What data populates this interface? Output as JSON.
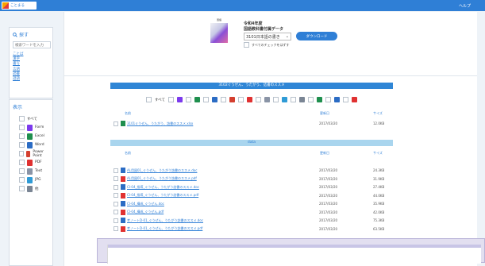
{
  "app": {
    "logo_text": "ことまる",
    "help_label": "ヘルプ"
  },
  "search": {
    "title": "探す",
    "placeholder": "検索ワードを入力",
    "links": [
      "ことば",
      "漢字",
      "書写",
      "言語",
      "読書",
      "話語"
    ]
  },
  "filters": {
    "title": "表示",
    "items": [
      {
        "label": "すべて",
        "icon_color": null
      },
      {
        "label": "Form",
        "icon_color": "#7c3aed"
      },
      {
        "label": "Excel",
        "icon_color": "#1f8f4e"
      },
      {
        "label": "Word",
        "icon_color": "#2b6cc4"
      },
      {
        "label": "Power Point",
        "icon_color": "#d43f2f"
      },
      {
        "label": "PDF",
        "icon_color": "#e03131"
      },
      {
        "label": "Text",
        "icon_color": "#8a94a6"
      },
      {
        "label": "JPG",
        "icon_color": "#2f9bd6"
      },
      {
        "label": "他",
        "icon_color": "#7a8594"
      }
    ]
  },
  "header": {
    "cover_top": "国語",
    "title_line1": "令和4年度",
    "title_line2": "国語教科書付属データ",
    "selected_book": "3101日本語の書き",
    "download_label": "ダウンロード",
    "check_all_label": "すべてのチェックをはずす"
  },
  "section1": {
    "title": "3102ぐうぜん、うたがう、詰書のススメ",
    "type_all_label": "すべて",
    "columns": {
      "name": "名前",
      "date": "更新日",
      "size": "サイズ"
    },
    "rows": [
      {
        "name": "3101ぐうぜん、うたがう、詰書のススメ.xlsx",
        "date": "2017/03/20",
        "size": "12.0KB",
        "icon_color": "#1f8f4e"
      }
    ]
  },
  "section2": {
    "title": "data",
    "columns": {
      "name": "名前",
      "date": "更新日",
      "size": "サイズ"
    },
    "rows": [
      {
        "name": "AL用図01_ぐうぜん、うたがう詰書のススメ.doc",
        "date": "2017/03/20",
        "size": "24.3KB",
        "icon_color": "#2b6cc4"
      },
      {
        "name": "AL用図01_ぐうぜん、うたがう詰書のススメ.pdf",
        "date": "2017/03/20",
        "size": "31.9KB",
        "icon_color": "#e03131"
      },
      {
        "name": "CI-04_指導_ぐうぜん、うたがう詰書のススメ.doc",
        "date": "2017/03/20",
        "size": "27.4KB",
        "icon_color": "#2b6cc4"
      },
      {
        "name": "CI-04_指導_ぐうぜん、うたがう詰書のススメ.pdf",
        "date": "2017/03/20",
        "size": "44.0KB",
        "icon_color": "#e03131"
      },
      {
        "name": "CI-04_構成_ぐうぜん.doc",
        "date": "2017/03/20",
        "size": "35.9KB",
        "icon_color": "#2b6cc4"
      },
      {
        "name": "CI-04_構成_ぐうぜん.pdf",
        "date": "2017/03/20",
        "size": "42.0KB",
        "icon_color": "#e03131"
      },
      {
        "name": "考ノートD-01_ぐうぜん、うたがう詰書のススメ.doc",
        "date": "2017/03/20",
        "size": "75.3KB",
        "icon_color": "#2b6cc4"
      },
      {
        "name": "考ノートD-01_ぐうぜん、うたがう詰書のススメ.pdf",
        "date": "2017/03/20",
        "size": "63.5KB",
        "icon_color": "#e03131"
      }
    ]
  },
  "type_chips": [
    "#7c3aed",
    "#1f8f4e",
    "#2b6cc4",
    "#d43f2f",
    "#e03131",
    "#8a94a6",
    "#2f9bd6",
    "#7a8594",
    "#1f8f4e",
    "#2b6cc4",
    "#e03131"
  ]
}
